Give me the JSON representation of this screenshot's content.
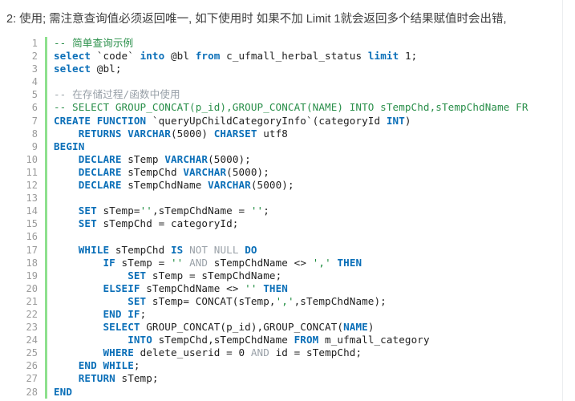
{
  "document": {
    "intro_text": "2: 使用; 需注意查询值必须返回唯一, 如下使用时 如果不加 Limit 1就会返回多个结果赋值时会出错,",
    "language": "sql",
    "gutter_accent_color": "#8ee08e",
    "background_color": "#ffffff",
    "colors": {
      "keyword": "#0b6fb8",
      "comment_grey": "#98a0a8",
      "comment_green": "#2a8f4a",
      "string": "#1a8a3c",
      "operator_grey": "#9aa1a8",
      "identifier": "#202020",
      "line_number": "#9b9b9b"
    }
  },
  "code": {
    "first_line_number": 1,
    "last_line_number": 28,
    "lines": [
      {
        "n": "1",
        "text": "-- 简单查询示例"
      },
      {
        "n": "2",
        "text": "select `code` into @bl from c_ufmall_herbal_status limit 1;"
      },
      {
        "n": "3",
        "text": "select @bl;"
      },
      {
        "n": "4",
        "text": ""
      },
      {
        "n": "5",
        "text": "-- 在存储过程/函数中使用"
      },
      {
        "n": "6",
        "text": "-- SELECT GROUP_CONCAT(p_id),GROUP_CONCAT(NAME) INTO sTempChd,sTempChdName FR"
      },
      {
        "n": "7",
        "text": "CREATE FUNCTION `queryUpChildCategoryInfo`(categoryId INT)"
      },
      {
        "n": "8",
        "text": "    RETURNS VARCHAR(5000) CHARSET utf8"
      },
      {
        "n": "9",
        "text": "BEGIN"
      },
      {
        "n": "10",
        "text": "    DECLARE sTemp VARCHAR(5000);"
      },
      {
        "n": "11",
        "text": "    DECLARE sTempChd VARCHAR(5000);"
      },
      {
        "n": "12",
        "text": "    DECLARE sTempChdName VARCHAR(5000);"
      },
      {
        "n": "13",
        "text": ""
      },
      {
        "n": "14",
        "text": "    SET sTemp='',sTempChdName = '';"
      },
      {
        "n": "15",
        "text": "    SET sTempChd = categoryId;"
      },
      {
        "n": "16",
        "text": ""
      },
      {
        "n": "17",
        "text": "    WHILE sTempChd IS NOT NULL DO"
      },
      {
        "n": "18",
        "text": "        IF sTemp = '' AND sTempChdName <> ',' THEN"
      },
      {
        "n": "19",
        "text": "            SET sTemp = sTempChdName;"
      },
      {
        "n": "20",
        "text": "        ELSEIF sTempChdName <> '' THEN"
      },
      {
        "n": "21",
        "text": "            SET sTemp= CONCAT(sTemp,',',sTempChdName);"
      },
      {
        "n": "22",
        "text": "        END IF;"
      },
      {
        "n": "23",
        "text": "        SELECT GROUP_CONCAT(p_id),GROUP_CONCAT(NAME)"
      },
      {
        "n": "24",
        "text": "            INTO sTempChd,sTempChdName FROM m_ufmall_category"
      },
      {
        "n": "25",
        "text": "        WHERE delete_userid = 0 AND id = sTempChd;"
      },
      {
        "n": "26",
        "text": "    END WHILE;"
      },
      {
        "n": "27",
        "text": "    RETURN sTemp;"
      },
      {
        "n": "28",
        "text": "END"
      }
    ]
  }
}
